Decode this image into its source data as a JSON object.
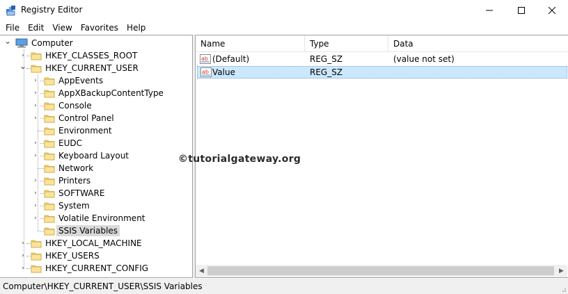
{
  "window": {
    "title": "Registry Editor",
    "minimize_glyph": "—",
    "maximize_glyph": "☐",
    "close_glyph": "✕"
  },
  "menu": [
    "File",
    "Edit",
    "View",
    "Favorites",
    "Help"
  ],
  "tree": {
    "root": "Computer",
    "hkcr": "HKEY_CLASSES_ROOT",
    "hkcu": "HKEY_CURRENT_USER",
    "hkcu_children": [
      "AppEvents",
      "AppXBackupContentType",
      "Console",
      "Control Panel",
      "Environment",
      "EUDC",
      "Keyboard Layout",
      "Network",
      "Printers",
      "SOFTWARE",
      "System",
      "Volatile Environment",
      "SSIS Variables"
    ],
    "hklm": "HKEY_LOCAL_MACHINE",
    "hku": "HKEY_USERS",
    "hkcc": "HKEY_CURRENT_CONFIG"
  },
  "list": {
    "columns": [
      "Name",
      "Type",
      "Data"
    ],
    "rows": [
      {
        "name": "(Default)",
        "type": "REG_SZ",
        "data": "(value not set)"
      },
      {
        "name": "Value",
        "type": "REG_SZ",
        "data": ""
      }
    ]
  },
  "watermark": "©tutorialgateway.org",
  "status": {
    "path": "Computer\\HKEY_CURRENT_USER\\SSIS Variables"
  },
  "colors": {
    "selection": "#cce8ff",
    "folder": "#f8d775",
    "tree_selected": "#d9d9d9"
  }
}
